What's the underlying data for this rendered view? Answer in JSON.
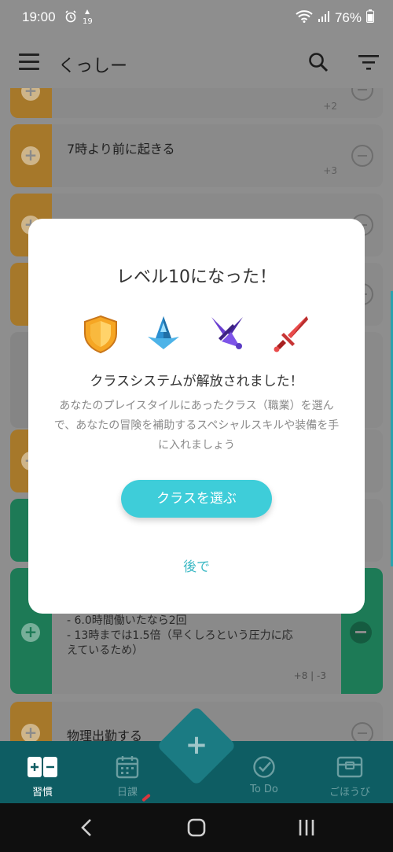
{
  "status_bar": {
    "time": "19:00",
    "battery": "76%"
  },
  "app_bar": {
    "title": "くっしー"
  },
  "list": {
    "cards": [
      {
        "count": "+2"
      },
      {
        "text": "7時より前に起きる",
        "count": "+3"
      }
    ],
    "green_card": {
      "notes": [
        "- 6.0時間働いたなら2回",
        "- 13時までは1.5倍（早くしろという圧力に応えているため）"
      ],
      "count": "+8 | -3"
    },
    "last_card": {
      "text": "物理出勤する"
    }
  },
  "modal": {
    "heading": "レベル10になった！",
    "subhead": "クラスシステムが解放されました！",
    "description": "あなたのプレイスタイルにあったクラス（職業）を選んで、あなたの冒険を補助するスペシャルスキルや装備を手に入れましょう",
    "choose_button": "クラスを選ぶ",
    "later_link": "後で",
    "class_icons": [
      "shield-icon",
      "crystal-icon",
      "dagger-icon",
      "sword-icon"
    ]
  },
  "bottom_nav": {
    "items": [
      {
        "label": "習慣",
        "icon": "habits-icon",
        "active": true
      },
      {
        "label": "日課",
        "icon": "calendar-icon",
        "active": false
      },
      {
        "label": "To Do",
        "icon": "check-icon",
        "active": false
      },
      {
        "label": "ごほうび",
        "icon": "rewards-icon",
        "active": false
      }
    ]
  },
  "colors": {
    "accent": "#3ecdd9",
    "nav": "#0e5d63",
    "habit_orange": "#a6782a",
    "habit_green": "#1d7a56"
  }
}
